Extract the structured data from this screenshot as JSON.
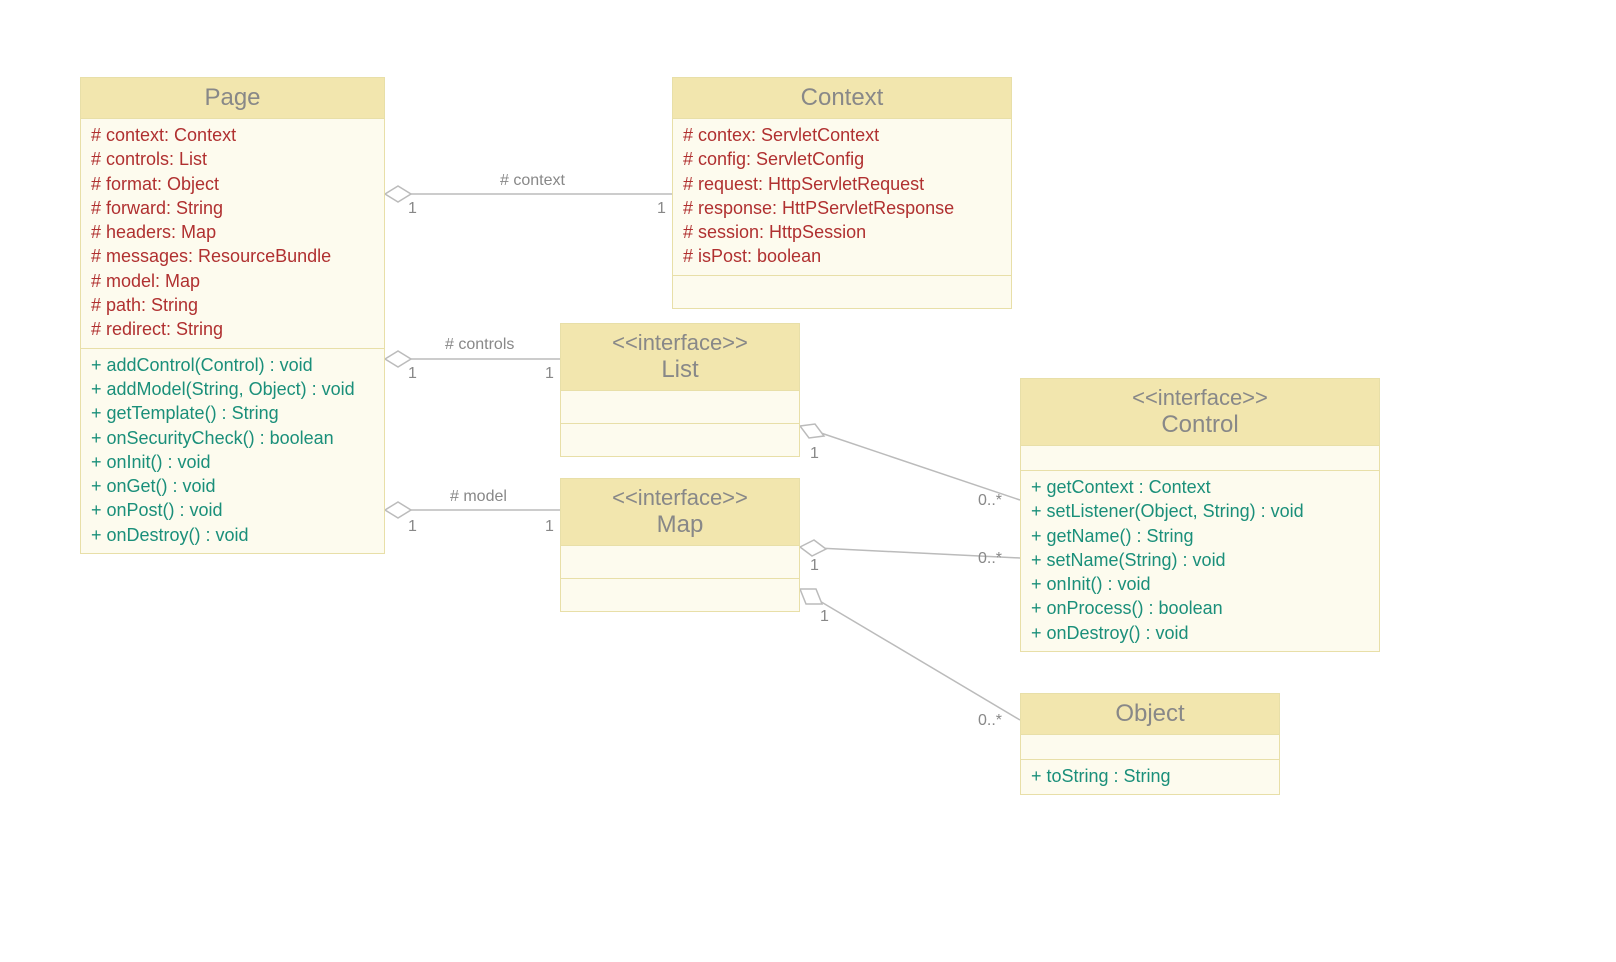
{
  "classes": {
    "page": {
      "title": "Page",
      "attrs": [
        "# context: Context",
        "# controls: List",
        "# format: Object",
        "# forward: String",
        "# headers: Map",
        "# messages: ResourceBundle",
        "# model: Map",
        "# path: String",
        "# redirect: String"
      ],
      "ops": [
        "+ addControl(Control) : void",
        "+ addModel(String, Object) : void",
        "+ getTemplate() : String",
        "+ onSecurityCheck() : boolean",
        "+ onInit() : void",
        "+ onGet() : void",
        "+ onPost() : void",
        "+ onDestroy() : void"
      ]
    },
    "context": {
      "title": "Context",
      "attrs": [
        "# contex: ServletContext",
        "# config: ServletConfig",
        "# request: HttpServletRequest",
        "# response: HttPServletResponse",
        "# session: HttpSession",
        "# isPost: boolean"
      ]
    },
    "list": {
      "stereo": "<<interface>>",
      "title": "List"
    },
    "map": {
      "stereo": "<<interface>>",
      "title": "Map"
    },
    "control": {
      "stereo": "<<interface>>",
      "title": "Control",
      "ops": [
        "+ getContext : Context",
        "+ setListener(Object, String) : void",
        "+ getName() : String",
        "+ setName(String) : void",
        "+ onInit() : void",
        "+ onProcess() : boolean",
        "+ onDestroy() : void"
      ]
    },
    "object": {
      "title": "Object",
      "ops": [
        "+ toString : String"
      ]
    }
  },
  "relations": {
    "page_context": {
      "label": "# context",
      "left_mult": "1",
      "right_mult": "1"
    },
    "page_list": {
      "label": "# controls",
      "left_mult": "1",
      "right_mult": "1"
    },
    "page_map": {
      "label": "# model",
      "left_mult": "1",
      "right_mult": "1"
    },
    "list_control": {
      "left_mult": "1",
      "right_mult": "0..*"
    },
    "map_control": {
      "left_mult": "1",
      "right_mult": "0..*"
    },
    "map_object": {
      "left_mult": "1",
      "right_mult": "0..*"
    }
  }
}
